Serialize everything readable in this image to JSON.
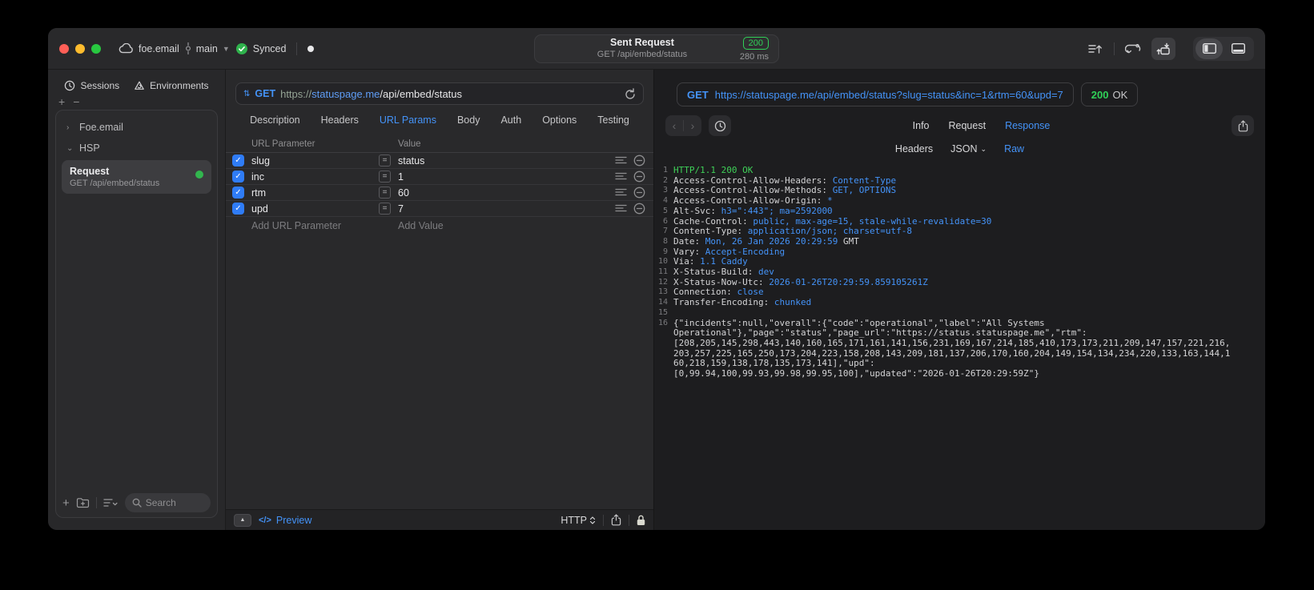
{
  "titlebar": {
    "project": "foe.email",
    "branch": "main",
    "sync_status": "Synced",
    "request_title": "Sent Request",
    "request_subtitle": "GET /api/embed/status",
    "status_code": "200",
    "duration": "280 ms"
  },
  "sidebar": {
    "tabs": [
      {
        "label": "Sessions"
      },
      {
        "label": "Environments"
      }
    ],
    "tree": [
      {
        "label": "Foe.email",
        "state": "collapsed"
      },
      {
        "label": "HSP",
        "state": "expanded"
      }
    ],
    "request_item": {
      "title": "Request",
      "subtitle": "GET /api/embed/status"
    },
    "search_placeholder": "Search"
  },
  "editor": {
    "method": "GET",
    "url_scheme": "https://",
    "url_host": "statuspage.me",
    "url_path": "/api/embed/status",
    "tabs": [
      "Description",
      "Headers",
      "URL Params",
      "Body",
      "Auth",
      "Options",
      "Testing"
    ],
    "active_tab": "URL Params",
    "table": {
      "columns": [
        "URL Parameter",
        "Value"
      ],
      "rows": [
        {
          "name": "slug",
          "value": "status",
          "enabled": true
        },
        {
          "name": "inc",
          "value": "1",
          "enabled": true
        },
        {
          "name": "rtm",
          "value": "60",
          "enabled": true
        },
        {
          "name": "upd",
          "value": "7",
          "enabled": true
        }
      ],
      "add_name_placeholder": "Add URL Parameter",
      "add_value_placeholder": "Add Value"
    },
    "footer": {
      "code_glyph": "</>",
      "preview_label": "Preview",
      "protocol": "HTTP"
    }
  },
  "response": {
    "method": "GET",
    "url": "https://statuspage.me/api/embed/status?slug=status&inc=1&rtm=60&upd=7",
    "status_code": "200",
    "status_text": "OK",
    "tabs": [
      "Info",
      "Request",
      "Response"
    ],
    "active_tab": "Response",
    "subtabs": [
      "Headers",
      "JSON",
      "Raw"
    ],
    "active_subtab": "Raw",
    "colors": {
      "accent_blue": "#4493f8",
      "status_green": "#30d158"
    },
    "lines": [
      {
        "n": "1",
        "segs": [
          {
            "c": "s",
            "t": "HTTP/1.1 200 OK"
          }
        ]
      },
      {
        "n": "2",
        "segs": [
          {
            "c": "n",
            "t": "Access-Control-Allow-Headers: "
          },
          {
            "c": "v",
            "t": "Content-Type"
          }
        ]
      },
      {
        "n": "3",
        "segs": [
          {
            "c": "n",
            "t": "Access-Control-Allow-Methods: "
          },
          {
            "c": "v",
            "t": "GET, OPTIONS"
          }
        ]
      },
      {
        "n": "4",
        "segs": [
          {
            "c": "n",
            "t": "Access-Control-Allow-Origin: "
          },
          {
            "c": "v",
            "t": "*"
          }
        ]
      },
      {
        "n": "5",
        "segs": [
          {
            "c": "n",
            "t": "Alt-Svc: "
          },
          {
            "c": "v",
            "t": "h3=\":443\"; ma=2592000"
          }
        ]
      },
      {
        "n": "6",
        "segs": [
          {
            "c": "n",
            "t": "Cache-Control: "
          },
          {
            "c": "v",
            "t": "public, max-age=15, stale-while-revalidate=30"
          }
        ]
      },
      {
        "n": "7",
        "segs": [
          {
            "c": "n",
            "t": "Content-Type: "
          },
          {
            "c": "v",
            "t": "application/json; charset=utf-8"
          }
        ]
      },
      {
        "n": "8",
        "segs": [
          {
            "c": "n",
            "t": "Date: "
          },
          {
            "c": "v",
            "t": "Mon, 26 Jan 2026 20:29:59"
          },
          {
            "c": "n",
            "t": " GMT"
          }
        ]
      },
      {
        "n": "9",
        "segs": [
          {
            "c": "n",
            "t": "Vary: "
          },
          {
            "c": "v",
            "t": "Accept-Encoding"
          }
        ]
      },
      {
        "n": "10",
        "segs": [
          {
            "c": "n",
            "t": "Via: "
          },
          {
            "c": "v",
            "t": "1.1 Caddy"
          }
        ]
      },
      {
        "n": "11",
        "segs": [
          {
            "c": "n",
            "t": "X-Status-Build: "
          },
          {
            "c": "v",
            "t": "dev"
          }
        ]
      },
      {
        "n": "12",
        "segs": [
          {
            "c": "n",
            "t": "X-Status-Now-Utc: "
          },
          {
            "c": "v",
            "t": "2026-01-26T20:29:59.859105261Z"
          }
        ]
      },
      {
        "n": "13",
        "segs": [
          {
            "c": "n",
            "t": "Connection: "
          },
          {
            "c": "v",
            "t": "close"
          }
        ]
      },
      {
        "n": "14",
        "segs": [
          {
            "c": "n",
            "t": "Transfer-Encoding: "
          },
          {
            "c": "v",
            "t": "chunked"
          }
        ]
      },
      {
        "n": "15",
        "segs": []
      },
      {
        "n": "16",
        "segs": [
          {
            "c": "b",
            "t": "{\"incidents\":null,\"overall\":{\"code\":\"operational\",\"label\":\"All Systems"
          }
        ]
      },
      {
        "n": "",
        "segs": [
          {
            "c": "b",
            "t": "Operational\"},\"page\":\"status\",\"page_url\":\"https://status.statuspage.me\",\"rtm\":"
          }
        ]
      },
      {
        "n": "",
        "segs": [
          {
            "c": "b",
            "t": "[208,205,145,298,443,140,160,165,171,161,141,156,231,169,167,214,185,410,173,173,211,209,147,157,221,216,"
          }
        ]
      },
      {
        "n": "",
        "segs": [
          {
            "c": "b",
            "t": "203,257,225,165,250,173,204,223,158,208,143,209,181,137,206,170,160,204,149,154,134,234,220,133,163,144,1"
          }
        ]
      },
      {
        "n": "",
        "segs": [
          {
            "c": "b",
            "t": "60,218,159,138,178,135,173,141],\"upd\":"
          }
        ]
      },
      {
        "n": "",
        "segs": [
          {
            "c": "b",
            "t": "[0,99.94,100,99.93,99.98,99.95,100],\"updated\":\"2026-01-26T20:29:59Z\"}"
          }
        ]
      }
    ]
  }
}
